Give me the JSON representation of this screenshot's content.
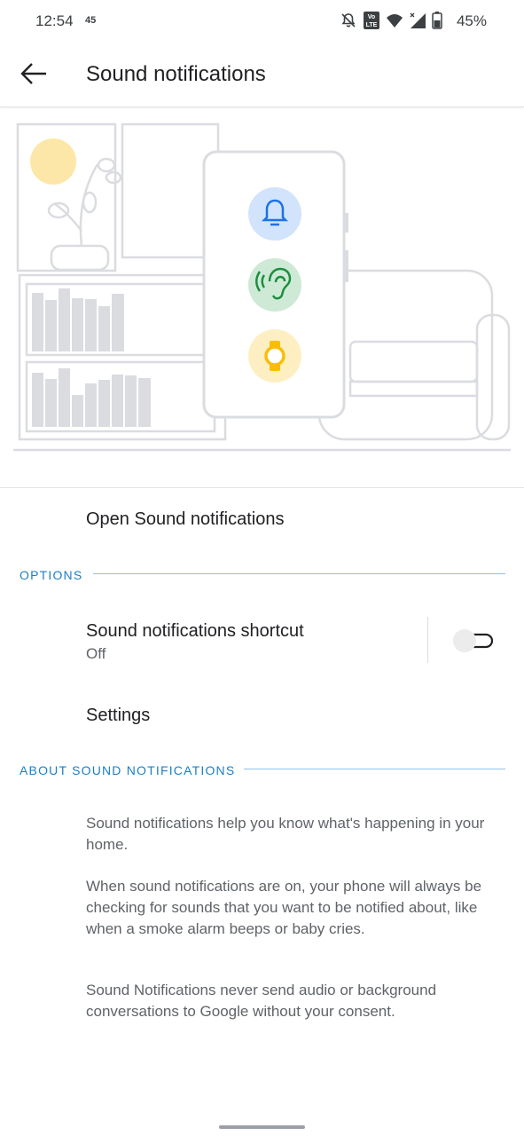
{
  "status_bar": {
    "time": "12:54",
    "extra": "45",
    "battery_text": "45%",
    "icons": [
      "bell-off-icon",
      "volte-icon",
      "wifi-icon",
      "signal-icon",
      "battery-icon"
    ]
  },
  "app_bar": {
    "title": "Sound notifications",
    "back_icon": "arrow-back-icon"
  },
  "main": {
    "open_label": "Open Sound notifications",
    "options_header": "OPTIONS",
    "shortcut": {
      "title": "Sound notifications shortcut",
      "subtitle": "Off",
      "toggle_on": false
    },
    "settings_label": "Settings",
    "about_header": "ABOUT SOUND NOTIFICATIONS",
    "about_paragraphs": [
      "Sound notifications help you know what's happening in your home.",
      "When sound notifications are on, your phone will always be checking for sounds that you want to be notified about, like when a smoke alarm beeps or baby cries.",
      "Sound Notifications never send audio or background conversations to Google without your consent."
    ]
  },
  "illustration": {
    "icons": [
      "bell-icon",
      "ear-icon",
      "watch-icon"
    ],
    "colors": {
      "bell_bg": "#d2e3fc",
      "bell_fg": "#1a73e8",
      "ear_bg": "#ceead6",
      "ear_fg": "#1e8e3e",
      "watch_bg": "#feefc3",
      "watch_fg": "#fbbc04",
      "sun": "#fde7a8",
      "outline": "#dadce0",
      "bars": "#dadce0"
    }
  },
  "colors": {
    "accent": "#1b80c4",
    "text_primary": "#202124",
    "text_secondary": "#5f6368"
  }
}
